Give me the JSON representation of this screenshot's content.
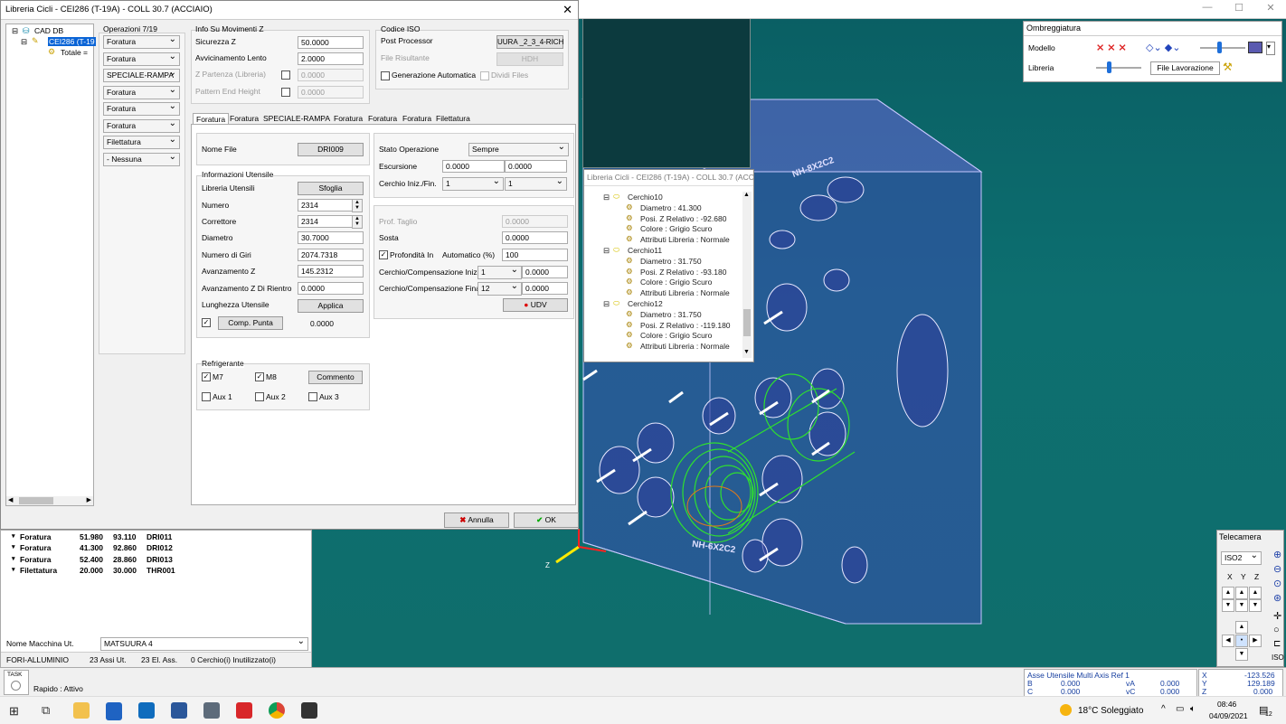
{
  "dialog": {
    "title": "Libreria Cicli - CEI286 (T-19A) - COLL 30.7 (ACCIAIO)",
    "tree": {
      "root": "CAD DB",
      "child": "CEI286 (T-19",
      "leaf": "Totale ="
    },
    "operations_header": "Operazioni 7/19",
    "operations": [
      "Foratura",
      "Foratura",
      "SPECIALE-RAMPA",
      "Foratura",
      "Foratura",
      "Foratura",
      "Filettatura",
      "- Nessuna"
    ],
    "info_z": {
      "header": "Info Su Movimenti Z",
      "sicurezza_label": "Sicurezza Z",
      "sicurezza_val": "50.0000",
      "avvicinamento_label": "Avvicinamento Lento",
      "avvicinamento_val": "2.0000",
      "zpartenza_label": "Z Partenza (Libreria)",
      "zpartenza_val": "0.0000",
      "pattern_label": "Pattern End Height",
      "pattern_val": "0.0000"
    },
    "iso": {
      "header": "Codice ISO",
      "post_label": "Post Processor",
      "post_val": "UURA _2_3_4-RICH",
      "file_label": "File Risultante",
      "file_val": "HDH",
      "gen_label": "Generazione Automatica",
      "divide_label": "Dividi Files"
    },
    "tabs": [
      "Foratura",
      "Foratura",
      "SPECIALE-RAMPA",
      "Foratura",
      "Foratura",
      "Foratura",
      "Filettatura"
    ],
    "left": {
      "nomefile_label": "Nome File",
      "nomefile_btn": "DRI009",
      "info_header": "Informazioni Utensile",
      "libreria_label": "Libreria Utensili",
      "sfoglia": "Sfoglia",
      "numero_label": "Numero",
      "numero_val": "2314",
      "correttore_label": "Correttore",
      "correttore_val": "2314",
      "diametro_label": "Diametro",
      "diametro_val": "30.7000",
      "giri_label": "Numero di Giri",
      "giri_val": "2074.7318",
      "avz_label": "Avanzamento Z",
      "avz_val": "145.2312",
      "avzr_label": "Avanzamento Z Di Rientro",
      "avzr_val": "0.0000",
      "lung_label": "Lunghezza Utensile",
      "applica": "Applica",
      "comp_btn": "Comp. Punta",
      "comp_val": "0.0000",
      "refr_header": "Refrigerante",
      "m7": "M7",
      "m8": "M8",
      "commento": "Commento",
      "aux1": "Aux 1",
      "aux2": "Aux 2",
      "aux3": "Aux 3"
    },
    "right": {
      "stato_label": "Stato Operazione",
      "stato_val": "Sempre",
      "escursione_label": "Escursione",
      "esc_val1": "0.0000",
      "esc_val2": "0.0000",
      "cerchio_label": "Cerchio Iniz./Fin.",
      "cerchio_v1": "1",
      "cerchio_v2": "1",
      "prof_label": "Prof. Taglio",
      "prof_val": "0.0000",
      "sosta_label": "Sosta",
      "sosta_val": "0.0000",
      "profin_label": "Profondità In",
      "auto_label": "Automatico (%)",
      "auto_val": "100",
      "comp1_label": "Cerchio/Compensazione Iniziale",
      "comp1_sel": "1",
      "comp1_val": "0.0000",
      "comp2_label": "Cerchio/Compensazione Finale",
      "comp2_sel": "12",
      "comp2_val": "0.0000",
      "udv": "UDV"
    },
    "annulla": "Annulla",
    "ok": "OK"
  },
  "treewin": {
    "title": "Libreria Cicli - CEI286 (T-19A) - COLL 30.7 (ACC",
    "items": [
      {
        "t": "Cerchio10",
        "lvl": 0
      },
      {
        "t": "Diametro : 41.300",
        "lvl": 1
      },
      {
        "t": "Posi. Z Relativo : -92.680",
        "lvl": 1
      },
      {
        "t": "Colore : Grigio Scuro",
        "lvl": 1
      },
      {
        "t": "Attributi Libreria : Normale",
        "lvl": 1
      },
      {
        "t": "Cerchio11",
        "lvl": 0
      },
      {
        "t": "Diametro : 31.750",
        "lvl": 1
      },
      {
        "t": "Posi. Z Relativo : -93.180",
        "lvl": 1
      },
      {
        "t": "Colore : Grigio Scuro",
        "lvl": 1
      },
      {
        "t": "Attributi Libreria : Normale",
        "lvl": 1
      },
      {
        "t": "Cerchio12",
        "lvl": 0
      },
      {
        "t": "Diametro : 31.750",
        "lvl": 1
      },
      {
        "t": "Posi. Z Relativo : -119.180",
        "lvl": 1
      },
      {
        "t": "Colore : Grigio Scuro",
        "lvl": 1
      },
      {
        "t": "Attributi Libreria : Normale",
        "lvl": 1
      }
    ]
  },
  "bottom": {
    "rows": [
      [
        "Foratura",
        "51.980",
        "93.110",
        "DRI011"
      ],
      [
        "Foratura",
        "41.300",
        "92.860",
        "DRI012"
      ],
      [
        "Foratura",
        "52.400",
        "28.860",
        "DRI013"
      ],
      [
        "Filettatura",
        "20.000",
        "30.000",
        "THR001"
      ]
    ],
    "machine_label": "Nome Macchina Ut.",
    "machine_val": "MATSUURA 4",
    "status": [
      "FORI-ALLUMINIO",
      "23 Assi Ut.",
      "23 El. Ass.",
      "0 Cerchio(i) Inutilizzato(i)"
    ]
  },
  "statusbar": {
    "task": "TASK",
    "rapido": "Rapido : Attivo",
    "axis_title": "Asse Utensile Multi Axis Ref  1",
    "B": "0.000",
    "C": "0.000",
    "vA": "0.000",
    "vC": "0.000",
    "X": "-123.526",
    "Y": "129.189",
    "Z": "0.000"
  },
  "ombr": {
    "title": "Ombreggiatura",
    "modello": "Modello",
    "libreria": "Libreria",
    "file": "File Lavorazione"
  },
  "telec": {
    "title": "Telecamera",
    "view": "ISO2",
    "x": "X",
    "y": "Y",
    "z": "Z"
  },
  "taskbar": {
    "weather": "18°C  Soleggiato",
    "time": "08:46",
    "date": "04/09/2021",
    "notif": "12"
  },
  "labels3d": [
    "NH-6X2C2",
    "NH-8X2C2"
  ]
}
